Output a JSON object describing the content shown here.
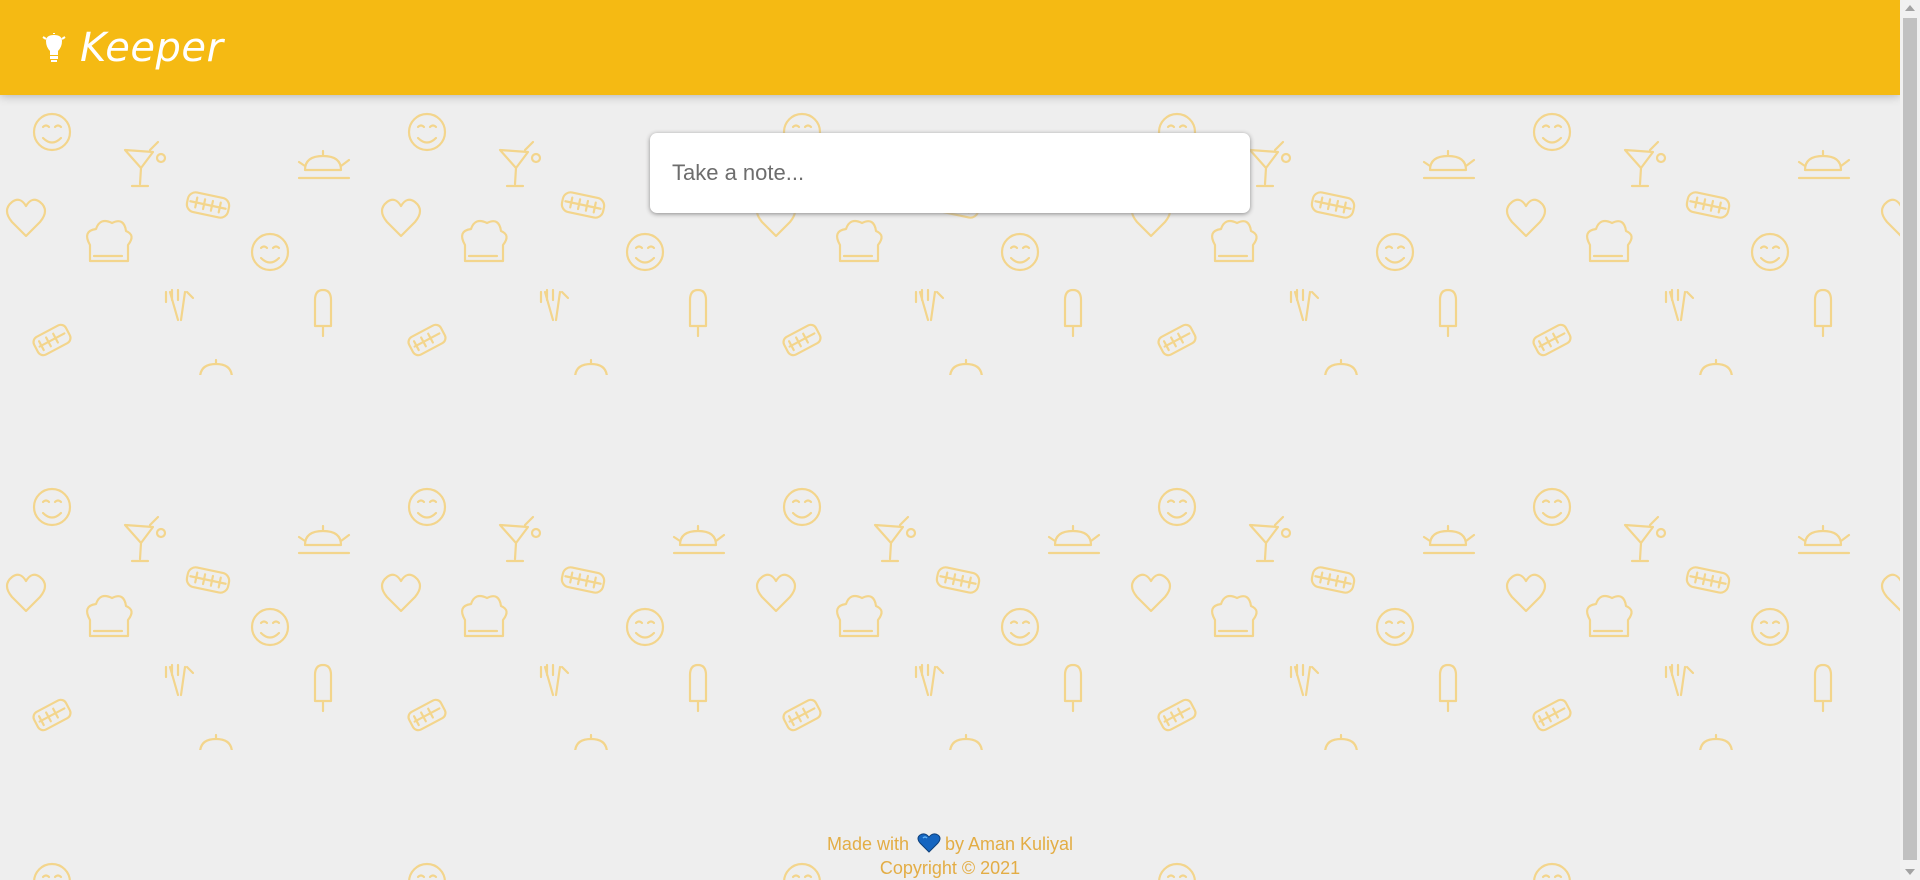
{
  "header": {
    "title": "Keeper",
    "logo_icon": "lightbulb-icon"
  },
  "note_form": {
    "placeholder": "Take a note..."
  },
  "footer": {
    "made_with": "Made with",
    "heart_icon": "blue-heart-icon",
    "author": "by Aman Kuliyal",
    "copyright": "Copyright © 2021"
  },
  "colors": {
    "header": "#f5ba13",
    "background": "#eeeeee",
    "pattern": "#f3d58c",
    "footer_text": "#e3ad45",
    "heart": "#1565c0"
  }
}
